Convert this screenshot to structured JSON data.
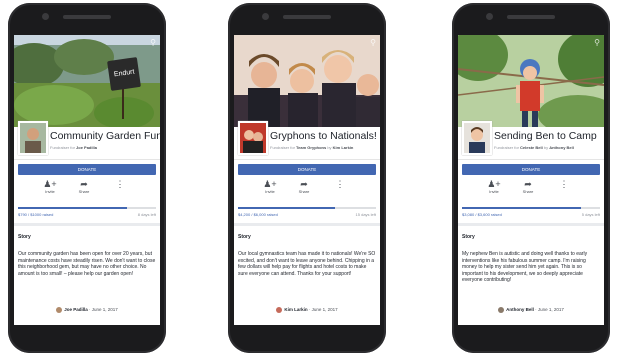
{
  "phones": [
    {
      "title": "Community Garden Fund",
      "byline_prefix": "Fundraiser for",
      "byline_name": "Joe Padilla",
      "donate_label": "DONATE",
      "invite_label": "Invite",
      "share_label": "Share",
      "raised_text": "$790 / $1000 raised",
      "days_left": "8 days left",
      "progress": 0.79,
      "story_label": "Story",
      "story_text": "Our community garden has been open for over 20 years, but maintenance costs have steadily risen. We don't want to close this neighborhood gem, but may have no other choice. No amount is too small! – please help our garden open!",
      "author": "Joe Padilla",
      "date": "· June 1, 2017",
      "photo_sign": "Endurt"
    },
    {
      "title": "Gryphons to Nationals!",
      "byline_prefix": "Fundraiser for",
      "byline_name": "Team Gryphons",
      "byline_by": "by",
      "byline_organizer": "Kim Larkin",
      "donate_label": "DONATE",
      "invite_label": "Invite",
      "share_label": "Share",
      "raised_text": "$4,200 / $6,000 raised",
      "days_left": "15 days left",
      "progress": 0.7,
      "story_label": "Story",
      "story_text": "Our local gymnastics team has made it to nationals! We're SO excited, and don't want to leave anyone behind. Chipping in a few dollars will help pay for flights and hotel costs to make sure everyone can attend. Thanks for your support!",
      "author": "Kim Larkin",
      "date": "· June 1, 2017"
    },
    {
      "title": "Sending Ben to Camp",
      "byline_prefix": "Fundraiser for",
      "byline_name": "Celeste Bell",
      "byline_by": "by",
      "byline_organizer": "Anthony Bell",
      "donate_label": "DONATE",
      "invite_label": "Invite",
      "share_label": "Share",
      "raised_text": "$3,080 / $3,600 raised",
      "days_left": "5 days left",
      "progress": 0.86,
      "story_label": "Story",
      "story_text": "My nephew Ben is autistic and doing well thanks to early interventions like his fabulous summer camp. I'm raising money to help my sister send him yet again. This is so important to his development, we so deeply appreciate everyone contributing!",
      "author": "Anthony Bell",
      "date": "· June 1, 2017"
    }
  ]
}
